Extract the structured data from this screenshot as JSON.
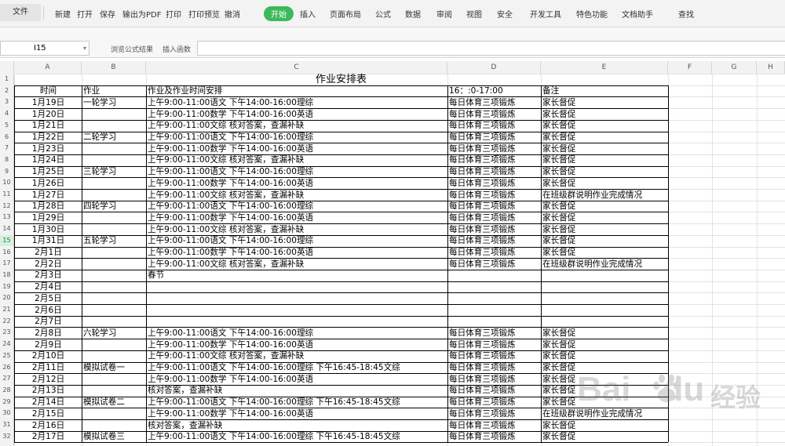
{
  "menubar": {
    "file": "文件",
    "items": [
      "新建",
      "打开",
      "保存",
      "输出为PDF",
      "打印",
      "打印预览",
      "撤消"
    ],
    "tabs": [
      "开始",
      "插入",
      "页面布局",
      "公式",
      "数据",
      "审阅",
      "视图",
      "安全",
      "开发工具",
      "特色功能",
      "文档助手"
    ],
    "active_tab": "开始",
    "search": "查找"
  },
  "formulabar": {
    "cell_ref": "I15",
    "browse_formula": "浏览公式结果",
    "insert_function": "插入函数",
    "formula": ""
  },
  "columns": [
    "A",
    "B",
    "C",
    "D",
    "E",
    "F",
    "G",
    "H"
  ],
  "sheet": {
    "title": "作业安排表",
    "header": [
      "时间",
      "作业",
      "作业及作业时间安排",
      "16：:0-17:00",
      "备注"
    ],
    "rows": [
      [
        "1月19日",
        "一轮学习",
        "上午9:00-11:00语文   下午14:00-16:00理综",
        "每日体育三项锻炼",
        "家长督促"
      ],
      [
        "1月20日",
        "",
        "上午9:00-11:00数学   下午14:00-16:00英语",
        "每日体育三项锻炼",
        "家长督促"
      ],
      [
        "1月21日",
        "",
        "上午9:00-11:00文综   核对答案，查漏补缺",
        "每日体育三项锻炼",
        "家长督促"
      ],
      [
        "1月22日",
        "二轮学习",
        "上午9:00-11:00语文   下午14:00-16:00理综",
        "每日体育三项锻炼",
        "家长督促"
      ],
      [
        "1月23日",
        "",
        "上午9:00-11:00数学   下午14:00-16:00英语",
        "每日体育三项锻炼",
        "家长督促"
      ],
      [
        "1月24日",
        "",
        "上午9:00-11:00文综   核对答案，查漏补缺",
        "每日体育三项锻炼",
        "家长督促"
      ],
      [
        "1月25日",
        "三轮学习",
        "上午9:00-11:00语文   下午14:00-16:00理综",
        "每日体育三项锻炼",
        "家长督促"
      ],
      [
        "1月26日",
        "",
        "上午9:00-11:00数学   下午14:00-16:00英语",
        "每日体育三项锻炼",
        "家长督促"
      ],
      [
        "1月27日",
        "",
        "上午9:00-11:00文综   核对答案，查漏补缺",
        "每日体育三项锻炼",
        "在班级群说明作业完成情况"
      ],
      [
        "1月28日",
        "四轮学习",
        "上午9:00-11:00语文   下午14:00-16:00理综",
        "每日体育三项锻炼",
        "家长督促"
      ],
      [
        "1月29日",
        "",
        "上午9:00-11:00数学   下午14:00-16:00英语",
        "每日体育三项锻炼",
        "家长督促"
      ],
      [
        "1月30日",
        "",
        "上午9:00-11:00文综   核对答案，查漏补缺",
        "每日体育三项锻炼",
        "家长督促"
      ],
      [
        "1月31日",
        "五轮学习",
        "上午9:00-11:00语文   下午14:00-16:00理综",
        "每日体育三项锻炼",
        "家长督促"
      ],
      [
        "2月1日",
        "",
        "上午9:00-11:00数学   下午14:00-16:00英语",
        "每日体育三项锻炼",
        "家长督促"
      ],
      [
        "2月2日",
        "",
        "上午9:00-11:00文综   核对答案，查漏补缺",
        "每日体育三项锻炼",
        "在班级群说明作业完成情况"
      ],
      [
        "2月3日",
        "",
        "春节",
        "",
        ""
      ],
      [
        "2月4日",
        "",
        "",
        "",
        ""
      ],
      [
        "2月5日",
        "",
        "",
        "",
        ""
      ],
      [
        "2月6日",
        "",
        "",
        "",
        ""
      ],
      [
        "2月7日",
        "",
        "",
        "",
        ""
      ],
      [
        "2月8日",
        "六轮学习",
        "上午9:00-11:00语文   下午14:00-16:00理综",
        "每日体育三项锻炼",
        "家长督促"
      ],
      [
        "2月9日",
        "",
        "上午9:00-11:00数学   下午14:00-16:00英语",
        "每日体育三项锻炼",
        "家长督促"
      ],
      [
        "2月10日",
        "",
        "上午9:00-11:00文综   核对答案，查漏补缺",
        "每日体育三项锻炼",
        "家长督促"
      ],
      [
        "2月11日",
        "模拟试卷一",
        "上午9:00-11:00语文   下午14:00-16:00理综   下午16:45-18:45文综",
        "每日体育三项锻炼",
        "家长督促"
      ],
      [
        "2月12日",
        "",
        "上午9:00-11:00数学   下午14:00-16:00英语",
        "每日体育三项锻炼",
        "家长督促"
      ],
      [
        "2月13日",
        "",
        "核对答案，查漏补缺",
        "每日体育三项锻炼",
        "家长督促"
      ],
      [
        "2月14日",
        "模拟试卷二",
        "上午9:00-11:00语文   下午14:00-16:00理综   下午16:45-18:45文综",
        "每日体育三项锻炼",
        "家长督促"
      ],
      [
        "2月15日",
        "",
        "上午9:00-11:00数学   下午14:00-16:00英语",
        "每日体育三项锻炼",
        "在班级群说明作业完成情况"
      ],
      [
        "2月16日",
        "",
        "核对答案，查漏补缺",
        "每日体育三项锻炼",
        "家长督促"
      ],
      [
        "2月17日",
        "模拟试卷三",
        "上午9:00-11:00语文   下午14:00-16:00理综   下午16:45-18:45文综",
        "每日体育三项锻炼",
        "家长督促"
      ]
    ]
  },
  "watermark": {
    "brand": "Bai",
    "brand_end": "du",
    "text": "经验"
  },
  "colors": {
    "accent": "#3cb95a",
    "active_row": "#d9efdd"
  }
}
